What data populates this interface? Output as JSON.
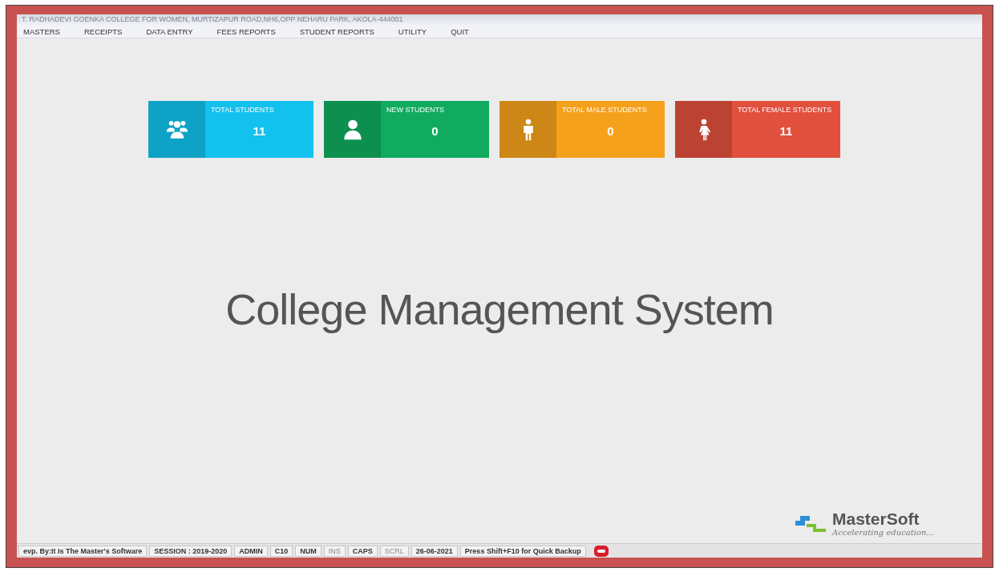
{
  "window": {
    "title": "T. RADHADEVI GOENKA COLLEGE FOR WOMEN, MURTIZAPUR ROAD,NH6,OPP NEHARU PARK, AKOLA-444001"
  },
  "menu": [
    "MASTERS",
    "RECEIPTS",
    "DATA ENTRY",
    "FEES REPORTS",
    "STUDENT REPORTS",
    "UTILITY",
    "QUIT"
  ],
  "cards": [
    {
      "kind": "group",
      "label": "TOTAL STUDENTS",
      "value": "11",
      "color": "#12c1ee"
    },
    {
      "kind": "person",
      "label": "NEW STUDENTS",
      "value": "0",
      "color": "#10ab5f"
    },
    {
      "kind": "male",
      "label": "TOTAL MALE STUDENTS",
      "value": "0",
      "color": "#f5a11c"
    },
    {
      "kind": "female",
      "label": "TOTAL FEMALE STUDENTS",
      "value": "11",
      "color": "#e0503d"
    }
  ],
  "heading": "College Management System",
  "logo": {
    "name": "MasterSoft",
    "tagline": "Accelerating education..."
  },
  "status_bar": [
    {
      "text": "evp. By:It Is The Master's Software",
      "active": true
    },
    {
      "text": "SESSION : 2019-2020",
      "active": true
    },
    {
      "text": "ADMIN",
      "active": true
    },
    {
      "text": "C10",
      "active": true
    },
    {
      "text": "NUM",
      "active": true
    },
    {
      "text": "INS",
      "active": false
    },
    {
      "text": "CAPS",
      "active": true
    },
    {
      "text": "SCRL",
      "active": false
    },
    {
      "text": "26-06-2021",
      "active": true
    },
    {
      "text": "Press Shift+F10 for Quick Backup",
      "active": true
    }
  ]
}
